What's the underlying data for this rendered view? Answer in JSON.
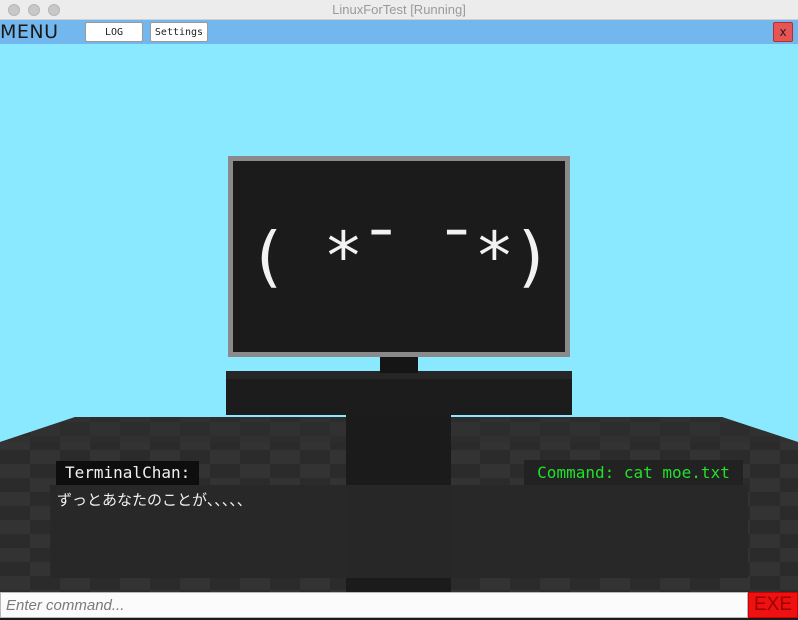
{
  "window": {
    "title": "LinuxForTest [Running]"
  },
  "menubar": {
    "menu_label": "MENU",
    "log_label": "LOG",
    "settings_label": "Settings",
    "close_label": "x"
  },
  "scene": {
    "face": "( *¯ ¯*)"
  },
  "dialogue": {
    "speaker": "TerminalChan:",
    "command": "Command: cat moe.txt",
    "text": "ずっとあなたのことが、、、、、"
  },
  "command_bar": {
    "placeholder": "Enter command...",
    "value": "",
    "exe_label": "EXE"
  },
  "colors": {
    "sky": "#8be9ff",
    "menubar": "#72b8ee",
    "command_text": "#22e02a",
    "exe_button": "#ee1111"
  }
}
